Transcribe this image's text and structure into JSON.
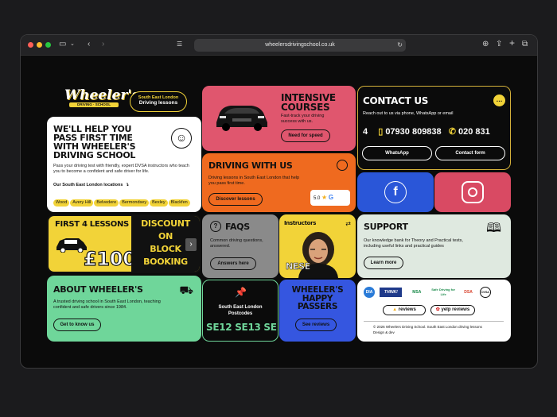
{
  "browser": {
    "url": "wheelersdrivingschool.co.uk"
  },
  "colors": {
    "pink": "#e0566e",
    "orange": "#ef6a1f",
    "yellow": "#f2d338",
    "green": "#6fd69a",
    "blue": "#3556e0",
    "mint": "#dfe9e0",
    "fb_blue": "#2a56d8"
  },
  "logo": {
    "text": "Wheeler's",
    "sub": "DRIVING · SCHOOL"
  },
  "location_badge": {
    "line1": "South East London",
    "line2": "Driving lessons"
  },
  "hero": {
    "title": "WE'LL HELP YOU PASS FIRST TIME WITH WHEELER'S DRIVING SCHOOL",
    "text": "Pass your driving test with friendly, expert DVSA instructors who teach you to become a confident and safe driver for life.",
    "locations_label": "Our South East London locations",
    "locations": [
      "Wood",
      "Avery Hill",
      "Belvedere",
      "Bermondsey",
      "Bexley",
      "Blackfen"
    ]
  },
  "intensive": {
    "title": "INTENSIVE COURSES",
    "text": "Fast-track your driving success with us.",
    "button": "Need for speed"
  },
  "contact": {
    "title": "CONTACT US",
    "text": "Reach out to us via phone, WhatsApp or email",
    "phone_prefix": "4",
    "phone1": "07930 809838",
    "phone2": "020 831",
    "whatsapp": "WhatsApp",
    "form": "Contact form"
  },
  "driving": {
    "title": "DRIVING WITH US",
    "text": "Driving lessons in South East London that help you pass first time.",
    "button": "Discover lessons",
    "rating": "5.0"
  },
  "offer": {
    "line1": "FIRST 4 LESSONS",
    "price": "£100",
    "discount": [
      "DISCOUNT",
      "ON",
      "BLOCK",
      "BOOKING"
    ]
  },
  "faqs": {
    "title": "FAQS",
    "text": "Common driving questions, answered.",
    "button": "Answers here"
  },
  "instructors": {
    "title": "Instructors",
    "name": "NESE"
  },
  "support": {
    "title": "SUPPORT",
    "text": "Our knowledge bank for Theory and Practical tests, including useful links and practical guides",
    "button": "Learn more"
  },
  "about": {
    "title": "ABOUT WHEELER'S",
    "text": "A trusted driving school in South East London, teaching confident and safe drivers since 1984.",
    "button": "Get to know us"
  },
  "postcodes": {
    "title": "South East London Postcodes",
    "codes": "SE12 SE13 SE1"
  },
  "passers": {
    "title": "WHEELER'S HAPPY PASSERS",
    "button": "See reviews"
  },
  "footer": {
    "badges": [
      "DIA",
      "THINK!",
      "MSA",
      "Safe Driving for Life",
      "DSA",
      "DVSA"
    ],
    "reviews": "reviews",
    "yelp": "yelp reviews",
    "copyright": "© 2026 Wheelers Driving School. South East London driving lessons",
    "credit": "Design & dev"
  }
}
